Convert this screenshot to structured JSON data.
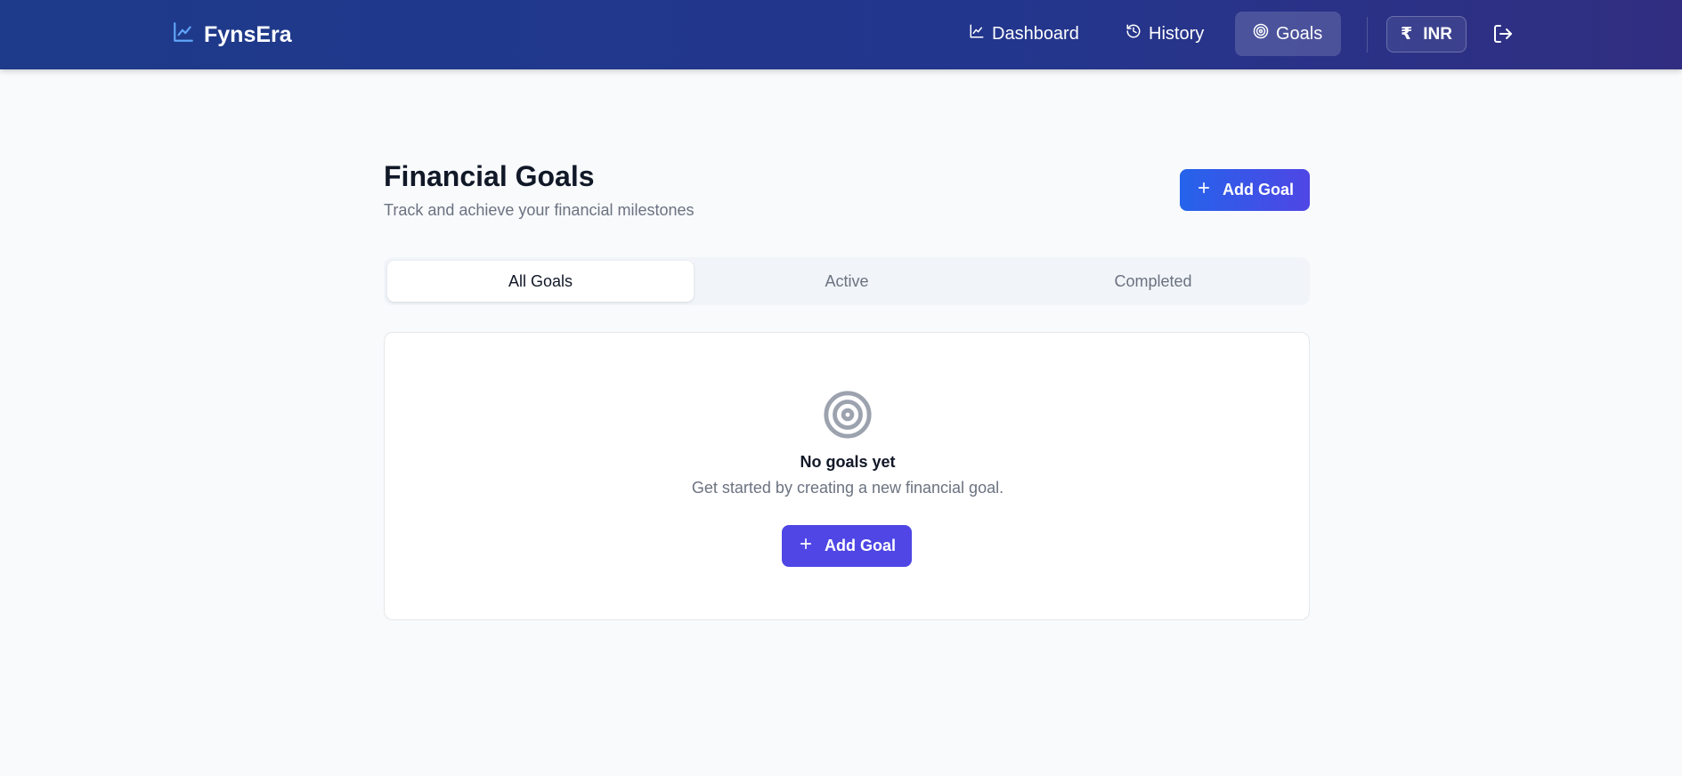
{
  "header": {
    "brand": "FynsEra",
    "nav": {
      "dashboard": "Dashboard",
      "history": "History",
      "goals": "Goals"
    },
    "currency": {
      "symbol": "₹",
      "code": "INR"
    }
  },
  "page": {
    "title": "Financial Goals",
    "subtitle": "Track and achieve your financial milestones",
    "add_button": "Add Goal"
  },
  "tabs": {
    "all": "All Goals",
    "active": "Active",
    "completed": "Completed"
  },
  "empty_state": {
    "title": "No goals yet",
    "description": "Get started by creating a new financial goal.",
    "button": "Add Goal"
  },
  "colors": {
    "header_start": "#1e3a8a",
    "header_end": "#312e81",
    "primary": "#4f46e5",
    "brand_icon": "#60a5fa"
  },
  "icons": [
    "line-chart-icon",
    "history-icon",
    "target-icon",
    "rupee-icon",
    "logout-icon",
    "plus-icon"
  ]
}
